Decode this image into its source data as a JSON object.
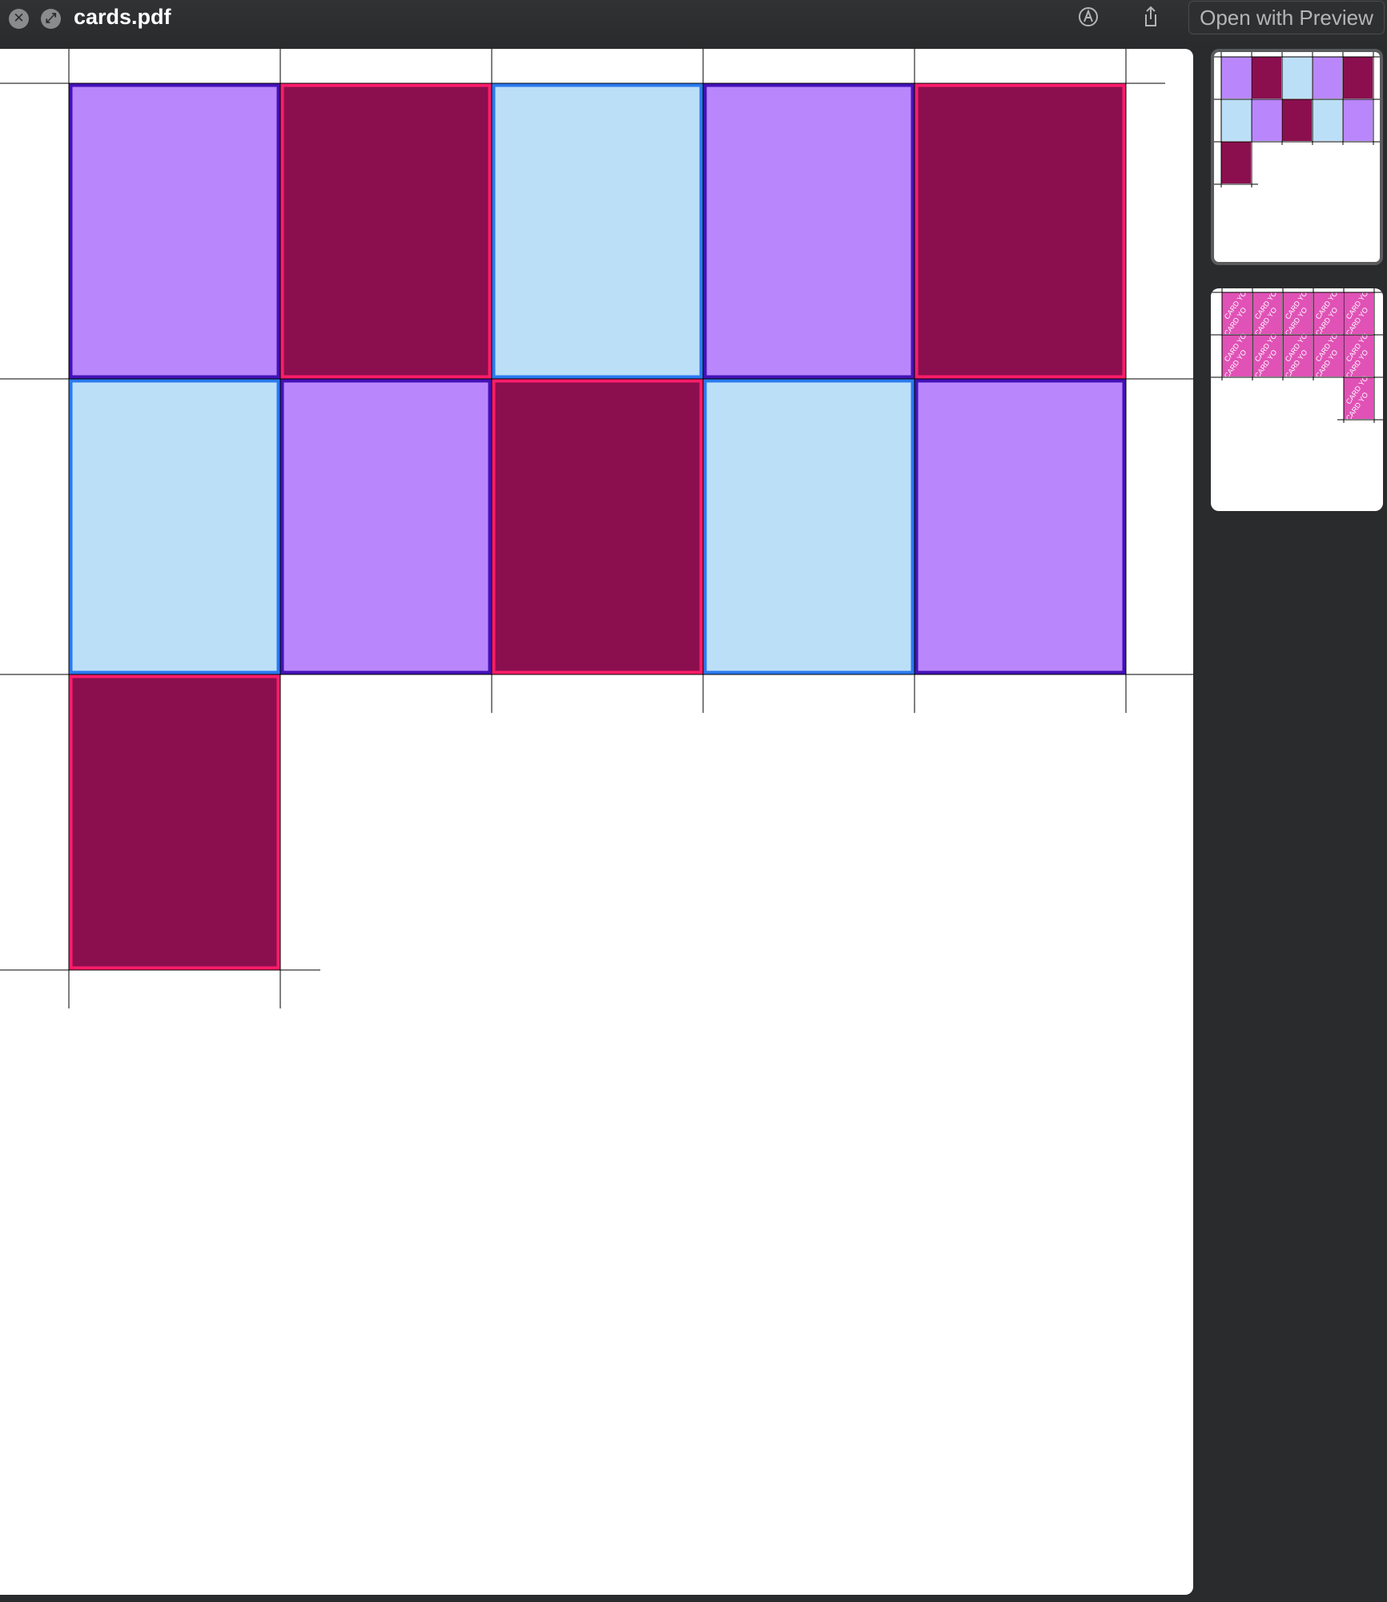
{
  "window": {
    "title": "cards.pdf",
    "close_icon": "close-icon",
    "fullscreen_icon": "fullscreen-icon",
    "markup_icon": "markup-pen-icon",
    "share_icon": "share-icon",
    "open_with_label": "Open with Preview"
  },
  "colors": {
    "purple_fill": "#b987fb",
    "purple_border": "#4412b8",
    "maroon_fill": "#8b0f4f",
    "maroon_border": "#ff1c6a",
    "blue_fill": "#bcdff8",
    "blue_border": "#2a7af0",
    "card_back_fill": "#e052b6",
    "card_back_text": "CARD YO"
  },
  "sheet": {
    "rows": [
      [
        "purple",
        "maroon",
        "blue",
        "purple",
        "maroon"
      ],
      [
        "blue",
        "purple",
        "maroon",
        "blue",
        "purple"
      ],
      [
        "maroon"
      ]
    ]
  },
  "thumbnails": [
    {
      "page": 1,
      "selected": true
    },
    {
      "page": 2,
      "selected": false
    }
  ]
}
